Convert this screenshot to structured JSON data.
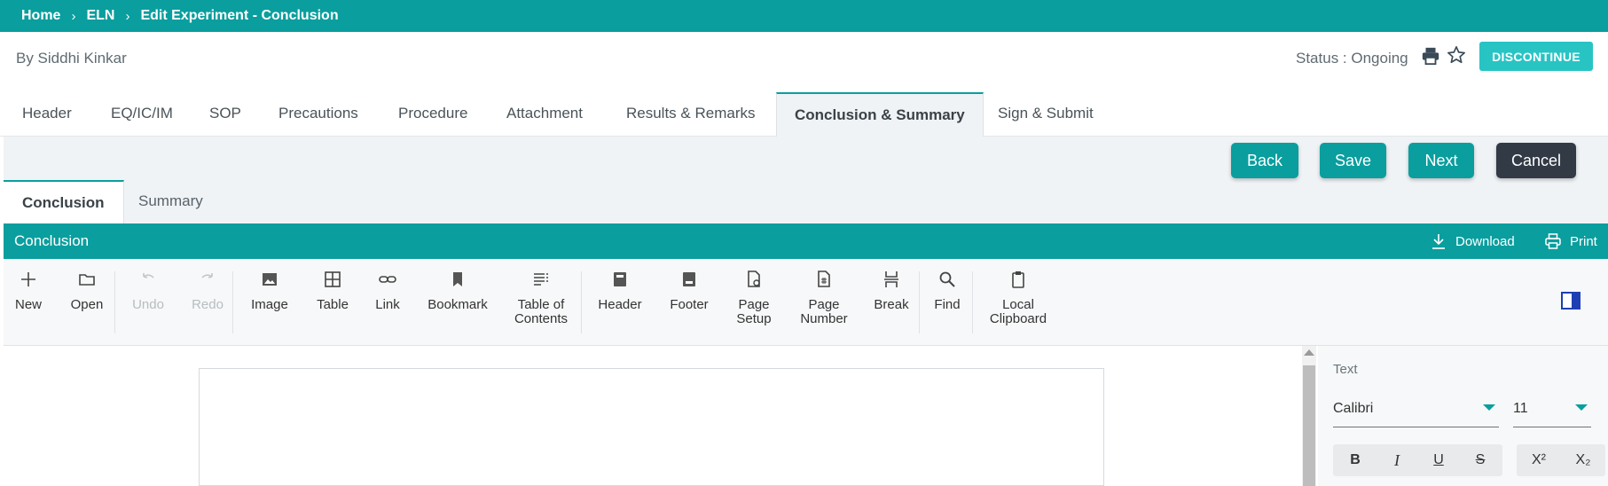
{
  "breadcrumb": {
    "home": "Home",
    "eln": "ELN",
    "current": "Edit Experiment - Conclusion",
    "separator": "›"
  },
  "author": "By Siddhi Kinkar",
  "status": "Status : Ongoing",
  "discontinue_label": "DISCONTINUE",
  "main_tabs": [
    {
      "label": "Header"
    },
    {
      "label": "EQ/IC/IM"
    },
    {
      "label": "SOP"
    },
    {
      "label": "Precautions"
    },
    {
      "label": "Procedure"
    },
    {
      "label": "Attachment"
    },
    {
      "label": "Results & Remarks"
    },
    {
      "label": "Conclusion & Summary",
      "active": true
    },
    {
      "label": "Sign & Submit"
    }
  ],
  "actions": {
    "back": "Back",
    "save": "Save",
    "next": "Next",
    "cancel": "Cancel"
  },
  "sub_tabs": [
    {
      "label": "Conclusion",
      "active": true
    },
    {
      "label": "Summary"
    }
  ],
  "panel": {
    "title": "Conclusion",
    "download": "Download",
    "print": "Print"
  },
  "ribbon": {
    "new": "New",
    "open": "Open",
    "undo": "Undo",
    "redo": "Redo",
    "image": "Image",
    "table": "Table",
    "link": "Link",
    "bookmark": "Bookmark",
    "toc_line1": "Table of",
    "toc_line2": "Contents",
    "header": "Header",
    "footer": "Footer",
    "page_setup_line1": "Page",
    "page_setup_line2": "Setup",
    "page_number_line1": "Page",
    "page_number_line2": "Number",
    "break": "Break",
    "find": "Find",
    "clipboard_line1": "Local",
    "clipboard_line2": "Clipboard"
  },
  "text_pane": {
    "label": "Text",
    "font": "Calibri",
    "size": "11",
    "bold": "B",
    "italic": "I",
    "underline": "U",
    "strike": "S",
    "superscript": "X²",
    "subscript": "X₂"
  },
  "colors": {
    "accent": "#0a9e9e",
    "discontinue": "#28c4c4",
    "cancel": "#323a46"
  }
}
